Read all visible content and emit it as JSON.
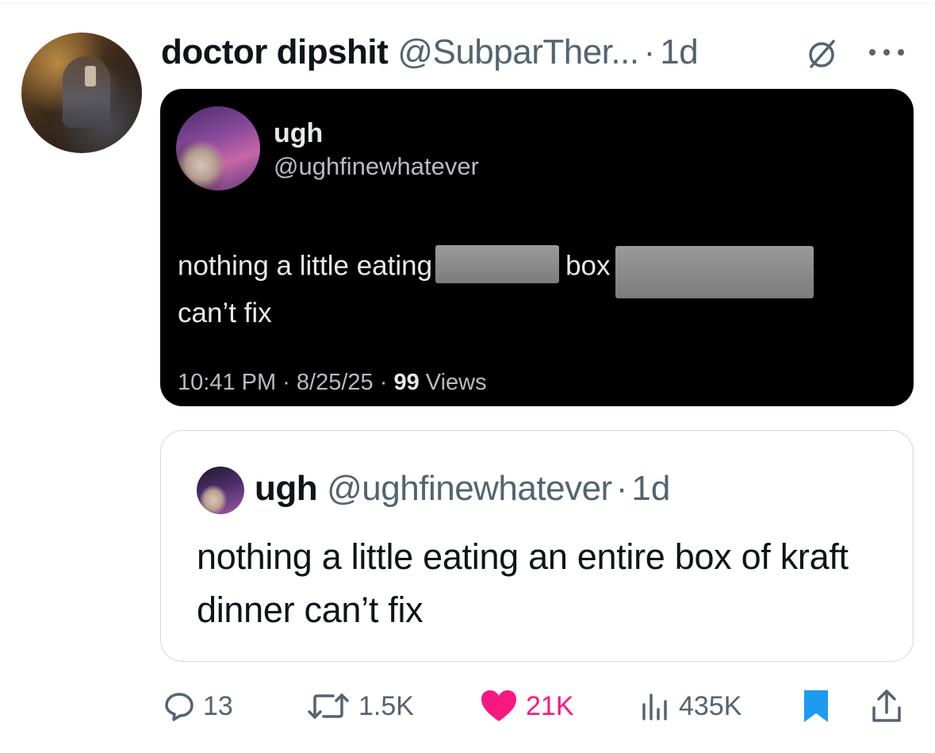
{
  "tweet": {
    "display_name": "doctor dipshit",
    "handle": "@SubparTher...",
    "separator": "·",
    "time": "1d"
  },
  "screenshot": {
    "name": "ugh",
    "handle": "@ughfinewhatever",
    "text_part1": "nothing a little eating",
    "text_part2": "box",
    "text_part3": "can’t fix",
    "meta_time": "10:41 PM · 8/25/25 · ",
    "meta_views_count": "99",
    "meta_views_label": " Views"
  },
  "quote": {
    "name": "ugh",
    "handle": "@ughfinewhatever",
    "separator": "·",
    "time": "1d",
    "text": "nothing a little eating an entire box of kraft dinner can’t fix"
  },
  "actions": {
    "replies": "13",
    "reposts": "1.5K",
    "likes": "21K",
    "views": "435K"
  },
  "colors": {
    "like": "#f91880",
    "bookmark": "#1d9bf0",
    "muted": "#536471"
  },
  "icons": [
    "no-entry-icon",
    "more-icon",
    "reply-icon",
    "repost-icon",
    "heart-icon",
    "views-icon",
    "bookmark-icon",
    "share-icon"
  ]
}
